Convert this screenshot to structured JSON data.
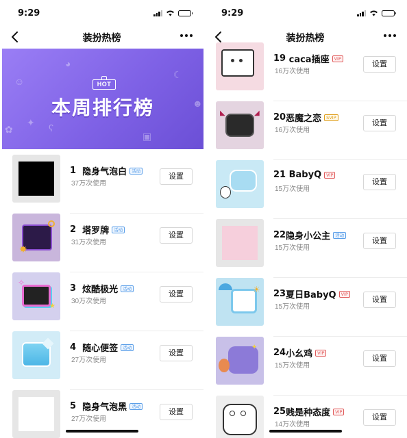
{
  "status": {
    "time": "9:29"
  },
  "navbar": {
    "title": "装扮热榜"
  },
  "banner": {
    "badge": "HOT",
    "headline": "本周排行榜"
  },
  "left_list": [
    {
      "rank": "1",
      "name": "隐身气泡白",
      "tag": "活动",
      "tag_type": "activity",
      "count": "37万次使用",
      "button": "设置"
    },
    {
      "rank": "2",
      "name": "塔罗牌",
      "tag": "活动",
      "tag_type": "activity",
      "count": "31万次使用",
      "button": "设置"
    },
    {
      "rank": "3",
      "name": "炫酷极光",
      "tag": "活动",
      "tag_type": "activity",
      "count": "30万次使用",
      "button": "设置"
    },
    {
      "rank": "4",
      "name": "随心便签",
      "tag": "活动",
      "tag_type": "activity",
      "count": "27万次使用",
      "button": "设置"
    },
    {
      "rank": "5",
      "name": "隐身气泡黑",
      "tag": "活动",
      "tag_type": "activity",
      "count": "27万次使用",
      "button": "设置"
    }
  ],
  "right_list": [
    {
      "rank": "19",
      "name": "caca插座",
      "tag": "VIP",
      "tag_type": "vip",
      "count": "16万次使用",
      "button": "设置"
    },
    {
      "rank": "20",
      "name": "恶魔之恋",
      "tag": "SVIP",
      "tag_type": "svip",
      "count": "16万次使用",
      "button": "设置"
    },
    {
      "rank": "21",
      "name": "BabyQ",
      "tag": "VIP",
      "tag_type": "vip",
      "count": "15万次使用",
      "button": "设置"
    },
    {
      "rank": "22",
      "name": "隐身小公主",
      "tag": "活动",
      "tag_type": "activity",
      "count": "15万次使用",
      "button": "设置"
    },
    {
      "rank": "23",
      "name": "夏日BabyQ",
      "tag": "VIP",
      "tag_type": "vip",
      "count": "15万次使用",
      "button": "设置"
    },
    {
      "rank": "24",
      "name": "小幺鸡",
      "tag": "VIP",
      "tag_type": "vip",
      "count": "15万次使用",
      "button": "设置"
    },
    {
      "rank": "25",
      "name": "贱是种态度",
      "tag": "VIP",
      "tag_type": "vip",
      "count": "14万次使用",
      "button": "设置"
    }
  ],
  "colors": {
    "banner": "#8a6eee",
    "activity_tag": "#5a9ee8",
    "vip_tag": "#e05a5a",
    "svip_tag": "#e0a020"
  }
}
